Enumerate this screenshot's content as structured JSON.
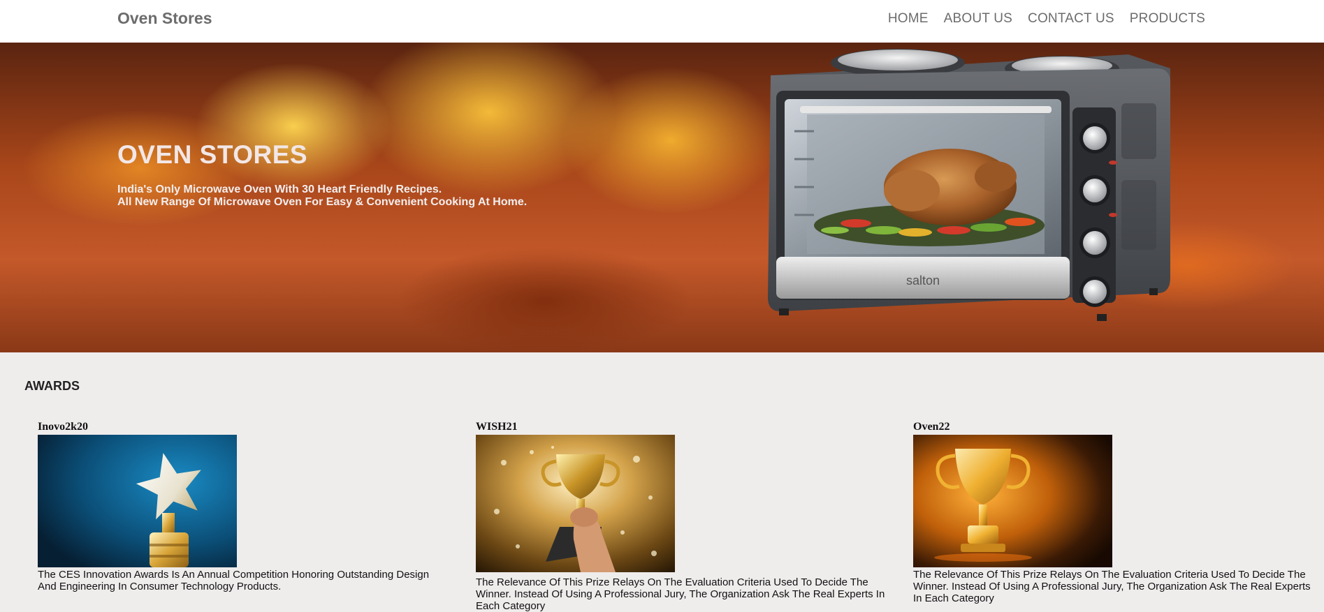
{
  "header": {
    "brand": "Oven Stores",
    "nav": [
      {
        "label": "HOME"
      },
      {
        "label": "ABOUT US"
      },
      {
        "label": "CONTACT US"
      },
      {
        "label": "PRODUCTS"
      }
    ]
  },
  "hero": {
    "title": "OVEN STORES",
    "line1": "India's Only Microwave Oven With 30 Heart Friendly Recipes.",
    "line2": "All New Range Of Microwave Oven For Easy & Convenient Cooking At Home.",
    "oven_brand": "salton"
  },
  "awards": {
    "title": "AWARDS",
    "cards": [
      {
        "name": "Inovo2k20",
        "description": "The CES Innovation Awards Is An Annual Competition Honoring Outstanding Design And Engineering In Consumer Technology Products.",
        "image": "star-trophy-image"
      },
      {
        "name": "WISH21",
        "description": "The Relevance Of This Prize Relays On The Evaluation Criteria Used To Decide The Winner. Instead Of Using A Professional Jury, The Organization Ask The Real Experts In Each Category",
        "image": "hand-holding-cup-image"
      },
      {
        "name": "Oven22",
        "description": "The Relevance Of This Prize Relays On The Evaluation Criteria Used To Decide The Winner. Instead Of Using A Professional Jury, The Organization Ask The Real Experts In Each Category",
        "image": "golden-cup-image"
      }
    ]
  },
  "colors": {
    "header_bg": "#ffffff",
    "nav_text": "#6c6c6c",
    "page_bg": "#efecec",
    "hero_text": "#f2e7e7"
  }
}
